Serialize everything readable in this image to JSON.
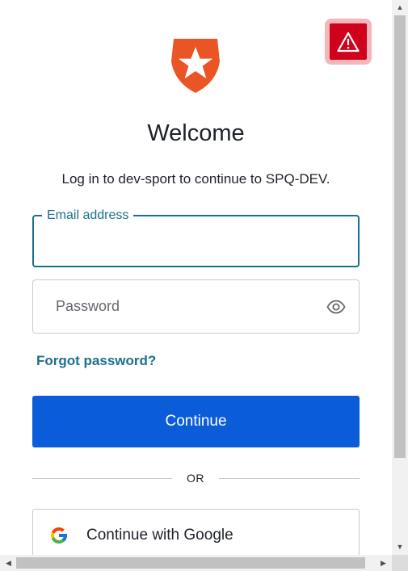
{
  "header": {
    "logo_icon": "auth0-shield-star-logo",
    "warning_icon": "warning-triangle-icon",
    "title": "Welcome",
    "subtitle": "Log in to dev-sport to continue to SPQ-DEV."
  },
  "form": {
    "email": {
      "label": "Email address",
      "value": ""
    },
    "password": {
      "placeholder": "Password",
      "value": "",
      "toggle_icon": "eye-icon"
    },
    "forgot_password": "Forgot password?",
    "continue_label": "Continue"
  },
  "divider": {
    "text": "OR"
  },
  "social": {
    "google_label": "Continue with Google",
    "google_icon": "google-g-icon"
  },
  "scrollbars": {
    "up_arrow": "▲",
    "down_arrow": "▼",
    "left_arrow": "◀",
    "right_arrow": "▶"
  },
  "colors": {
    "primary_button": "#0a5cd8",
    "link_and_focus": "#1a6f8e",
    "logo_orange": "#eb5424",
    "warning_red": "#d0021b",
    "text": "#1e212a"
  }
}
